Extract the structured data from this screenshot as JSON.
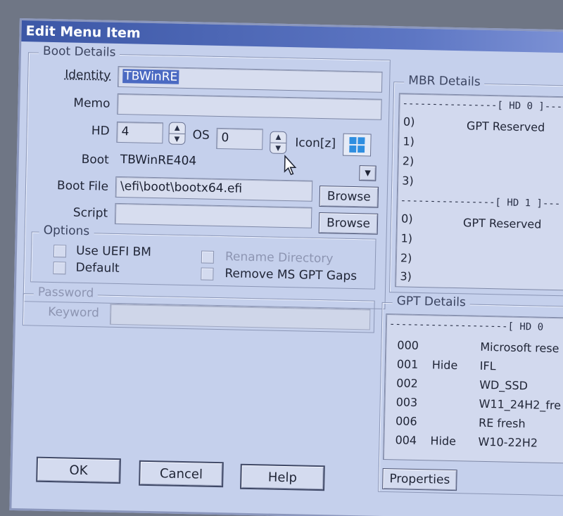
{
  "window": {
    "title": "Edit Menu Item"
  },
  "boot_details": {
    "group_title": "Boot Details",
    "identity": {
      "label": "Identity",
      "value": "TBWinRE"
    },
    "memo": {
      "label": "Memo",
      "value": ""
    },
    "hd": {
      "label": "HD",
      "value": "4"
    },
    "os": {
      "label": "OS",
      "value": "0"
    },
    "icon": {
      "label": "Icon[z]"
    },
    "boot": {
      "label": "Boot",
      "value": "TBWinRE404"
    },
    "boot_file": {
      "label": "Boot File",
      "value": "\\efi\\boot\\bootx64.efi",
      "browse_label": "Browse"
    },
    "script": {
      "label": "Script",
      "value": "",
      "browse_label": "Browse"
    },
    "options": {
      "group_title": "Options",
      "use_uefi_bm": "Use UEFI BM",
      "default": "Default",
      "rename_directory": "Rename Directory",
      "remove_ms_gpt_gaps": "Remove MS GPT Gaps"
    }
  },
  "password": {
    "group_title": "Password",
    "keyword_label": "Keyword",
    "keyword_value": ""
  },
  "mbr_details": {
    "group_title": "MBR Details",
    "hd0_header": "----------------[ HD 0 ]---",
    "hd0_rows": [
      {
        "idx": "0)",
        "name": "GPT Reserved"
      },
      {
        "idx": "1)",
        "name": ""
      },
      {
        "idx": "2)",
        "name": ""
      },
      {
        "idx": "3)",
        "name": ""
      }
    ],
    "hd1_header": "----------------[ HD 1 ]---",
    "hd1_rows": [
      {
        "idx": "0)",
        "name": "GPT Reserved"
      },
      {
        "idx": "1)",
        "name": ""
      },
      {
        "idx": "2)",
        "name": ""
      },
      {
        "idx": "3)",
        "name": ""
      }
    ]
  },
  "gpt_details": {
    "group_title": "GPT Details",
    "header": "--------------------[ HD 0",
    "rows": [
      {
        "num": "000",
        "flag": "",
        "name": "Microsoft rese"
      },
      {
        "num": "001",
        "flag": "Hide",
        "name": "IFL"
      },
      {
        "num": "002",
        "flag": "",
        "name": "WD_SSD"
      },
      {
        "num": "003",
        "flag": "",
        "name": "W11_24H2_fre"
      },
      {
        "num": "006",
        "flag": "",
        "name": "RE fresh"
      },
      {
        "num": "004",
        "flag": "Hide",
        "name": "W10-22H2"
      }
    ],
    "properties_label": "Properties"
  },
  "footer": {
    "ok_label": "OK",
    "cancel_label": "Cancel",
    "help_label": "Help"
  }
}
